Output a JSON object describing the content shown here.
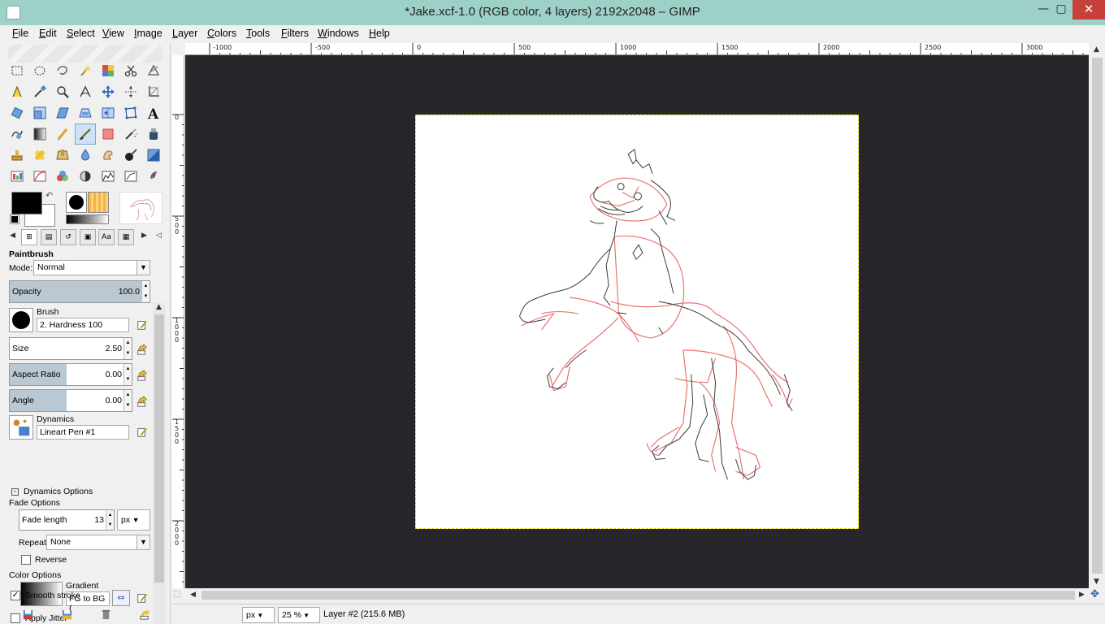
{
  "window": {
    "title": "*Jake.xcf-1.0 (RGB color, 4 layers) 2192x2048 – GIMP",
    "minimize_glyph": "—",
    "maximize_glyph": "▢",
    "close_glyph": "✕"
  },
  "menubar": {
    "items": [
      "File",
      "Edit",
      "Select",
      "View",
      "Image",
      "Layer",
      "Colors",
      "Tools",
      "Filters",
      "Windows",
      "Help"
    ]
  },
  "toolbox": {
    "tools": [
      "rect-select-icon",
      "ellipse-select-icon",
      "free-select-icon",
      "fuzzy-select-icon",
      "select-by-color-icon",
      "scissors-icon",
      "foreground-select-icon",
      "paths-icon",
      "color-picker-icon",
      "zoom-icon",
      "measure-icon",
      "move-icon",
      "align-icon",
      "crop-icon",
      "rotate-icon",
      "scale-icon",
      "shear-icon",
      "perspective-icon",
      "flip-icon",
      "cage-icon",
      "text-icon",
      "warp-icon",
      "blend-icon",
      "pencil-icon",
      "paintbrush-icon",
      "eraser-icon",
      "airbrush-icon",
      "ink-icon",
      "clone-icon",
      "heal-icon",
      "perspective-clone-icon",
      "blur-icon",
      "smudge-icon",
      "dodge-burn-icon",
      "bucket-fill-icon",
      "levels-icon",
      "curves-icon",
      "color-balance-icon",
      "hue-saturation-icon",
      "threshold-icon",
      "posterize-icon",
      "spiral-icon"
    ],
    "active_tool": "paintbrush-icon",
    "fg_color": "#000000",
    "bg_color": "#ffffff"
  },
  "tool_options": {
    "title": "Paintbrush",
    "mode_label": "Mode:",
    "mode_value": "Normal",
    "opacity_label": "Opacity",
    "opacity_value": "100.0",
    "opacity_fraction": 1.0,
    "brush_label": "Brush",
    "brush_value": "2. Hardness 100",
    "size_label": "Size",
    "size_value": "2.50",
    "aspect_label": "Aspect Ratio",
    "aspect_value": "0.00",
    "angle_label": "Angle",
    "angle_value": "0.00",
    "dynamics_label": "Dynamics",
    "dynamics_value": "Lineart Pen #1",
    "dynamics_options_label": "Dynamics Options",
    "fade_options_label": "Fade Options",
    "fade_length_label": "Fade length",
    "fade_length_value": "13",
    "fade_unit": "px",
    "repeat_label": "Repeat:",
    "repeat_value": "None",
    "reverse_label": "Reverse",
    "color_options_label": "Color Options",
    "gradient_label": "Gradient",
    "gradient_value": "FG to BG (",
    "apply_jitter_label": "Apply Jitter",
    "smooth_stroke_label": "Smooth stroke",
    "smooth_stroke_checked": "✓"
  },
  "rulers": {
    "top_labels": [
      "-1000",
      "-500",
      "0",
      "500",
      "1000",
      "1500",
      "2000",
      "2500",
      "3000"
    ],
    "left_labels": [
      "0",
      "5\n0\n0",
      "1\n0\n0\n0",
      "1\n5\n0\n0",
      "2\n0\n0\n0"
    ]
  },
  "statusbar": {
    "unit": "px",
    "zoom": "25 %",
    "status": "Layer #2 (215.6 MB)"
  },
  "colors": {
    "titlebar": "#9dd1c8",
    "canvas_bg": "#27262a",
    "sketch_red": "#e8746f",
    "ink": "#3a3a3a"
  }
}
